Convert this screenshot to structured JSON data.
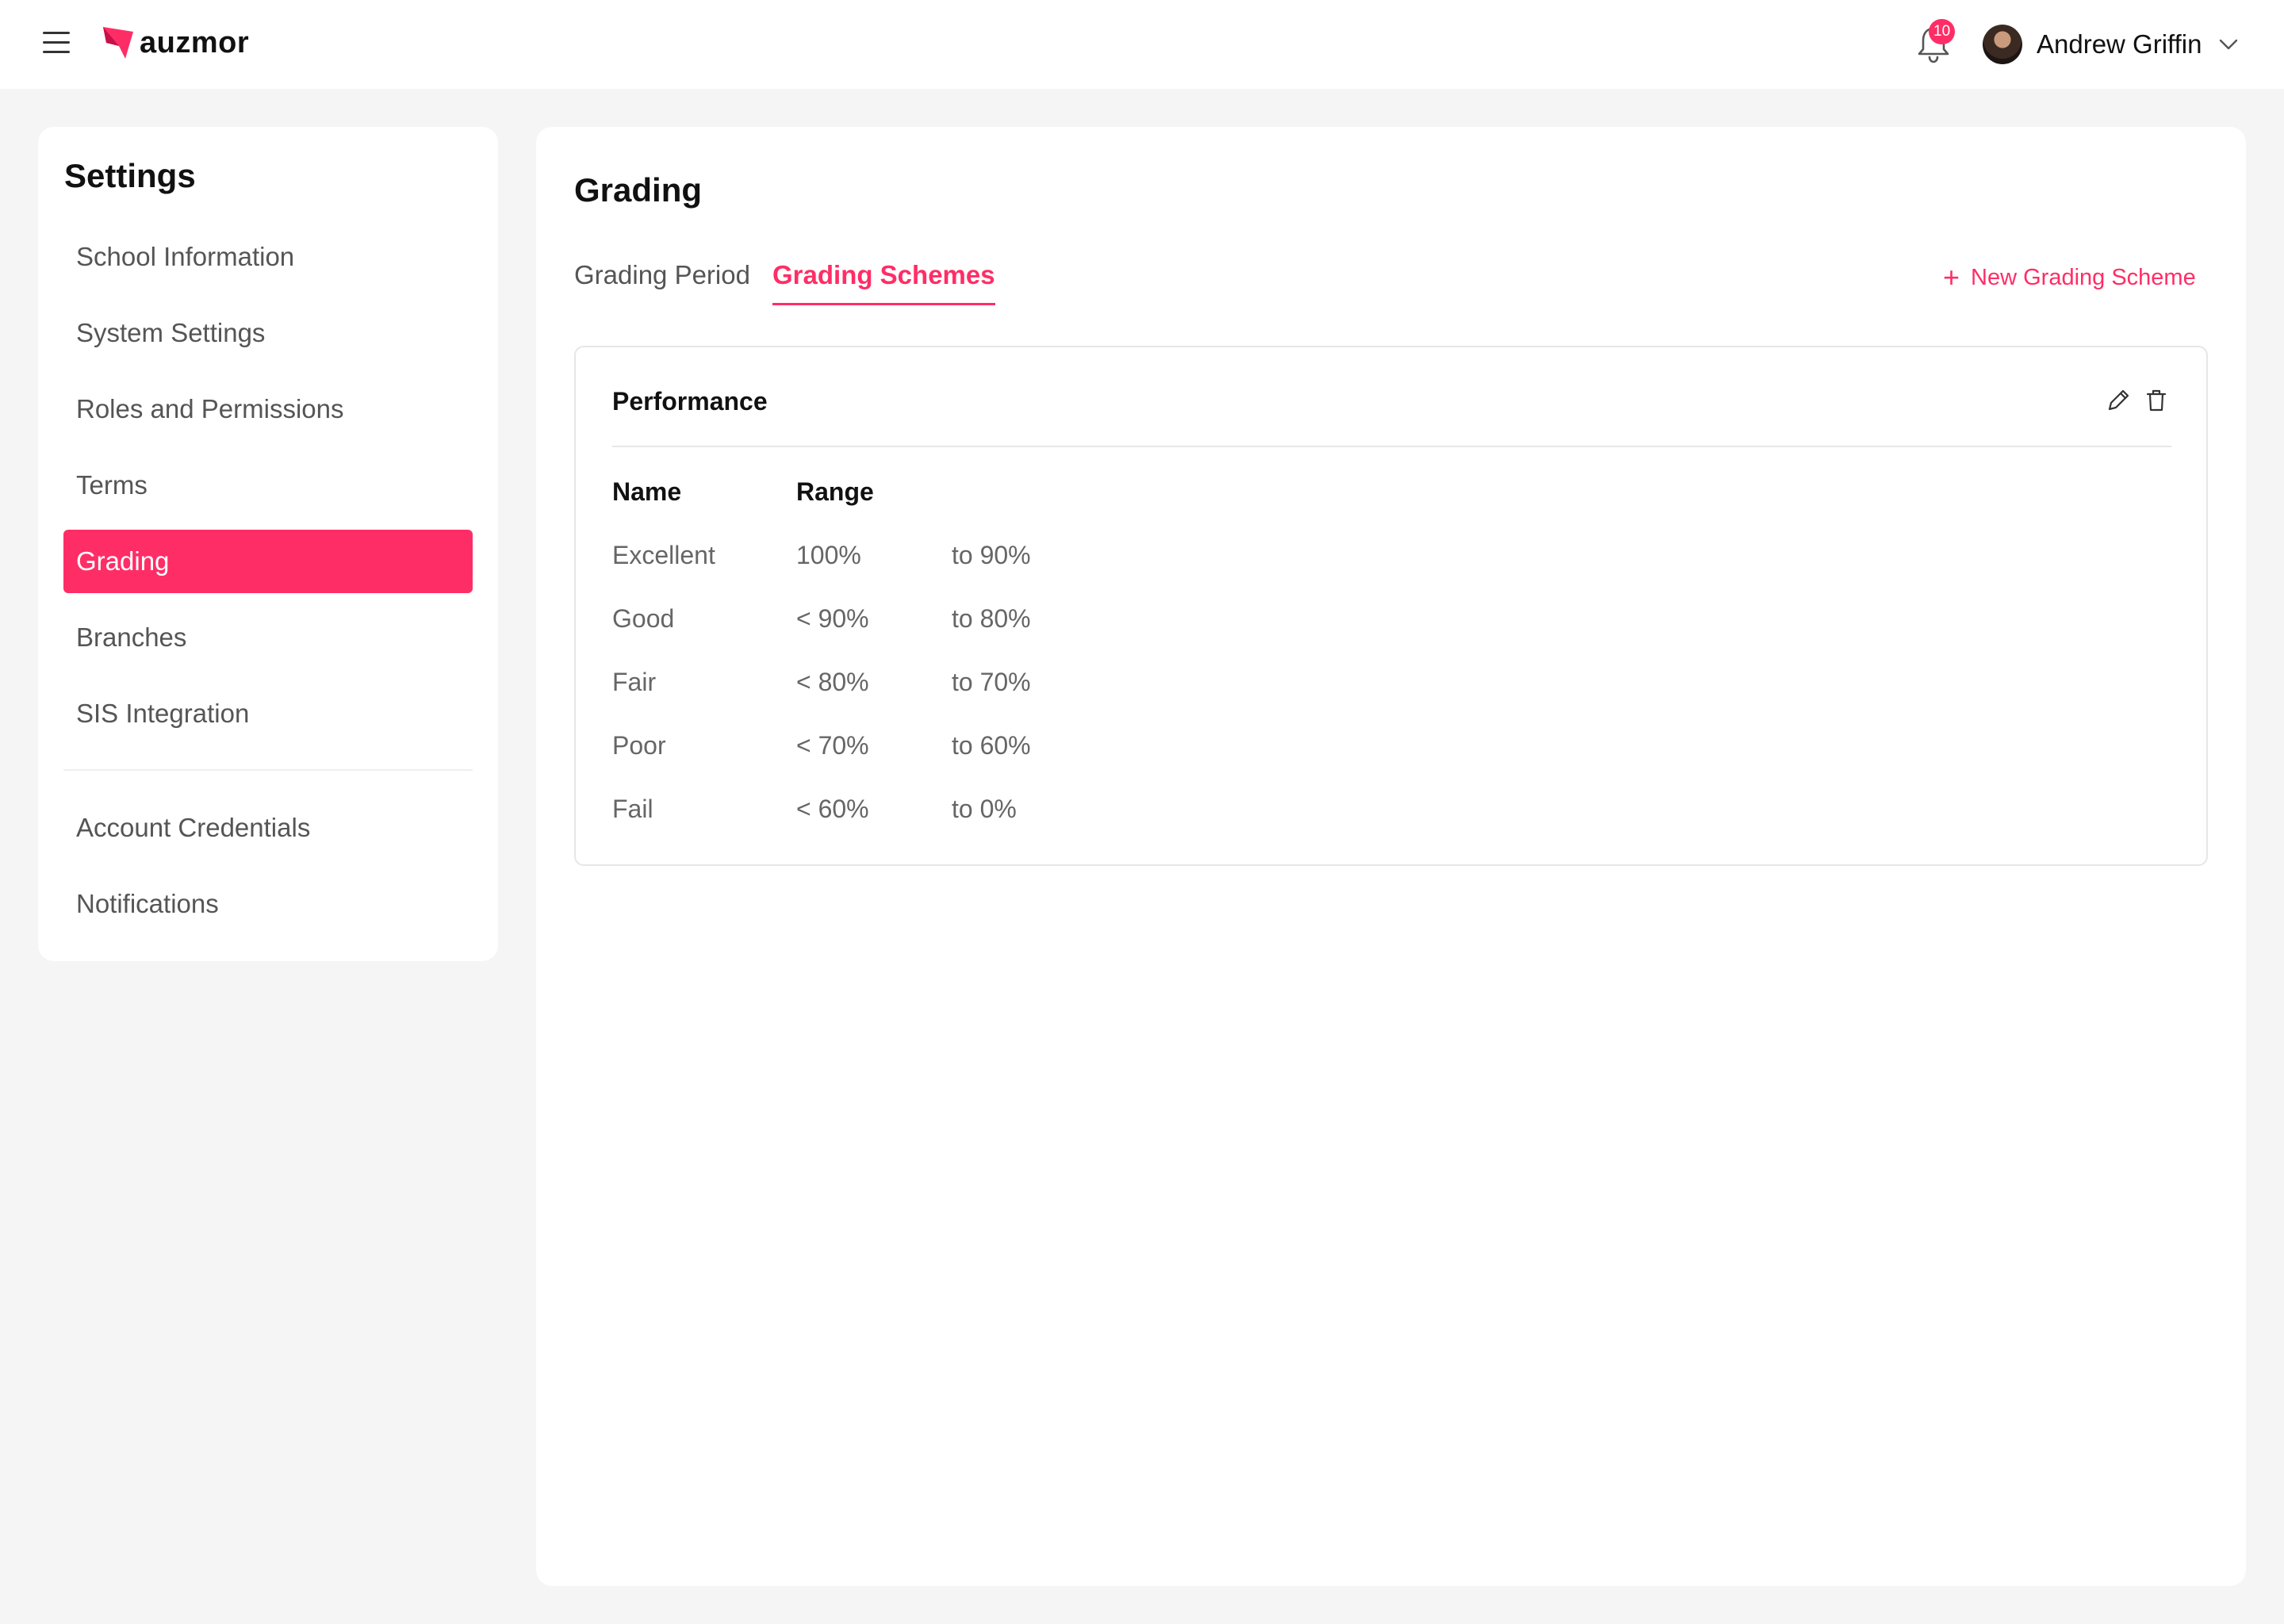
{
  "header": {
    "brand": "auzmor",
    "notification_count": "10",
    "user_name": "Andrew Griffin",
    "icons": [
      "menu-icon",
      "auzmor-logo",
      "bell-icon",
      "avatar",
      "chevron-down-icon"
    ]
  },
  "sidebar": {
    "title": "Settings",
    "items": [
      {
        "label": "School Information"
      },
      {
        "label": "System Settings"
      },
      {
        "label": "Roles and Permissions"
      },
      {
        "label": "Terms"
      },
      {
        "label": "Grading",
        "active": true
      },
      {
        "label": "Branches"
      },
      {
        "label": "SIS Integration"
      }
    ],
    "secondary_items": [
      {
        "label": "Account Credentials"
      },
      {
        "label": "Notifications"
      }
    ]
  },
  "main": {
    "title": "Grading",
    "tabs": [
      {
        "label": "Grading Period"
      },
      {
        "label": "Grading Schemes",
        "active": true
      }
    ],
    "new_scheme_label": "New Grading Scheme",
    "scheme": {
      "name": "Performance",
      "columns": [
        "Name",
        "Range"
      ],
      "rows": [
        {
          "name": "Excellent",
          "from": "100%",
          "to": "to 90%"
        },
        {
          "name": "Good",
          "from": "< 90%",
          "to": "to 80%"
        },
        {
          "name": "Fair",
          "from": "< 80%",
          "to": "to 70%"
        },
        {
          "name": "Poor",
          "from": "< 70%",
          "to": "to 60%"
        },
        {
          "name": "Fail",
          "from": "< 60%",
          "to": "to 0%"
        }
      ]
    }
  },
  "colors": {
    "accent": "#ff2d66",
    "background": "#f5f5f5",
    "panel": "#ffffff",
    "text_muted": "#555555"
  }
}
